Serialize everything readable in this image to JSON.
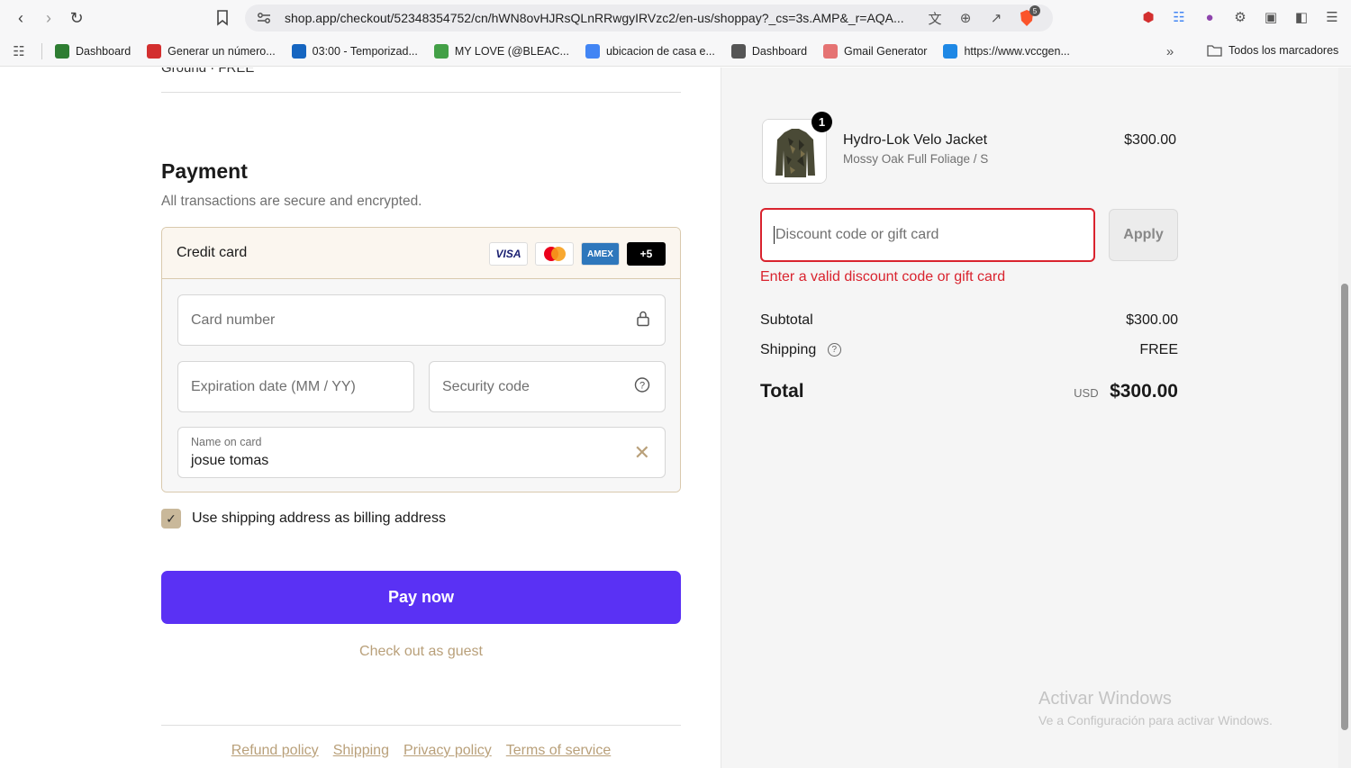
{
  "browser": {
    "url": "shop.app/checkout/52348354752/cn/hWN8ovHJRsQLnRRwgyIRVzc2/en-us/shoppay?_cs=3s.AMP&_r=AQA...",
    "extension_badge": "5",
    "bookmarks": [
      {
        "label": "Dashboard",
        "icon": "cactus-icon",
        "color": "#2e7d32"
      },
      {
        "label": "Generar un número...",
        "icon": "f-icon",
        "color": "#d32f2f"
      },
      {
        "label": "03:00 - Temporizad...",
        "icon": "timer-check-icon",
        "color": "#1565c0"
      },
      {
        "label": "MY LOVE (@BLEAC...",
        "icon": "bolt-icon",
        "color": "#43a047"
      },
      {
        "label": "ubicacion de casa e...",
        "icon": "google-icon",
        "color": "#4285f4"
      },
      {
        "label": "Dashboard",
        "icon": "globe-icon",
        "color": "#555555"
      },
      {
        "label": "Gmail Generator",
        "icon": "gmail-generator-icon",
        "color": "#e57373"
      },
      {
        "label": "https://www.vccgen...",
        "icon": "v-icon",
        "color": "#1e88e5"
      }
    ],
    "bookmarks_folder": "Todos los marcadores"
  },
  "checkout": {
    "shipping_cut_label": "Ground · FREE",
    "payment": {
      "title": "Payment",
      "subtitle": "All transactions are secure and encrypted.",
      "method_label": "Credit card",
      "card_logos": [
        "VISA",
        "",
        "AMEX",
        "+5"
      ],
      "card_number_placeholder": "Card number",
      "expiration_placeholder": "Expiration date (MM / YY)",
      "security_placeholder": "Security code",
      "name_label": "Name on card",
      "name_value": "josue tomas"
    },
    "billing_checkbox_label": "Use shipping address as billing address",
    "billing_checked": true,
    "pay_button": "Pay now",
    "guest_link": "Check out as guest",
    "footer_links": [
      "Refund policy",
      "Shipping",
      "Privacy policy",
      "Terms of service"
    ]
  },
  "summary": {
    "product": {
      "name": "Hydro-Lok Velo Jacket",
      "variant": "Mossy Oak Full Foliage / S",
      "price": "$300.00",
      "quantity": "1"
    },
    "discount_placeholder": "Discount code or gift card",
    "apply_button": "Apply",
    "discount_error": "Enter a valid discount code or gift card",
    "subtotal_label": "Subtotal",
    "subtotal_value": "$300.00",
    "shipping_label": "Shipping",
    "shipping_value": "FREE",
    "total_label": "Total",
    "total_currency": "USD",
    "total_value": "$300.00"
  },
  "watermark": {
    "line1": "Activar Windows",
    "line2": "Ve a Configuración para activar Windows."
  },
  "colors": {
    "accent": "#5a31f4",
    "error": "#d9232e",
    "link": "#b9a07a"
  }
}
